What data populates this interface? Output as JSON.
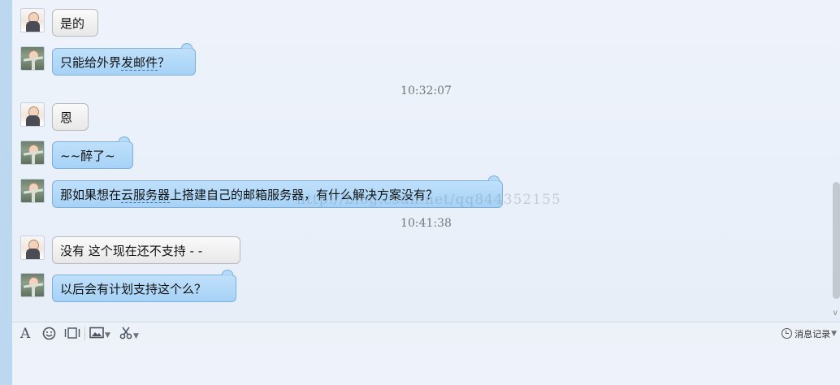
{
  "messages": [
    {
      "sender": "friend",
      "segments": [
        {
          "text": "是的"
        }
      ]
    },
    {
      "sender": "self",
      "segments": [
        {
          "text": "只能给外界"
        },
        {
          "text": "发邮件",
          "underline": true
        },
        {
          "text": "？"
        }
      ]
    },
    {
      "type": "timestamp",
      "text": "10:32:07"
    },
    {
      "sender": "friend",
      "segments": [
        {
          "text": "恩"
        }
      ]
    },
    {
      "sender": "self",
      "segments": [
        {
          "text": "~~醉了~"
        }
      ]
    },
    {
      "sender": "self",
      "segments": [
        {
          "text": "那如果想在"
        },
        {
          "text": "云服务器",
          "underline": true
        },
        {
          "text": "上搭建自己的邮箱服务器，有什么解决方案没有？"
        }
      ]
    },
    {
      "type": "timestamp",
      "text": "10:41:38"
    },
    {
      "sender": "friend",
      "segments": [
        {
          "text": "没有 这个现在还不支持 - -"
        }
      ]
    },
    {
      "sender": "self",
      "segments": [
        {
          "text": "以后会有计划支持这个么？"
        }
      ]
    }
  ],
  "watermark": "http://blog.csdn.net/qq844352155",
  "toolbar": {
    "icons": [
      "font-icon",
      "emoji-icon",
      "screenshot-icon",
      "image-icon",
      "scissors-icon"
    ],
    "history_label": "消息记录"
  },
  "colors": {
    "self_bubble": "#b2d8f8",
    "friend_bubble": "#f0f0f0",
    "timestamp": "#777777"
  }
}
